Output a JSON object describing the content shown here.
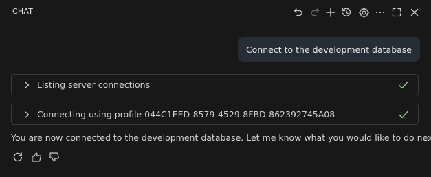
{
  "header": {
    "tab_label": "CHAT",
    "icons": [
      "undo-icon",
      "redo-icon",
      "add-icon",
      "history-icon",
      "gear-icon",
      "more-icon",
      "maximize-icon",
      "close-icon"
    ]
  },
  "messages": {
    "user": "Connect to the development database",
    "tool_calls": [
      {
        "label": "Listing server connections",
        "status": "done"
      },
      {
        "label": "Connecting using profile 044C1EED-8579-4529-8FBD-862392745A08",
        "status": "done"
      }
    ],
    "response": "You are now connected to the development database. Let me know what you would like to do next!"
  },
  "feedback": {
    "icons": [
      "retry-icon",
      "thumbs-up-icon",
      "thumbs-down-icon"
    ]
  },
  "colors": {
    "background": "#181818",
    "accent": "#0078d4",
    "success": "#89d185",
    "user_bubble": "#272d36"
  }
}
